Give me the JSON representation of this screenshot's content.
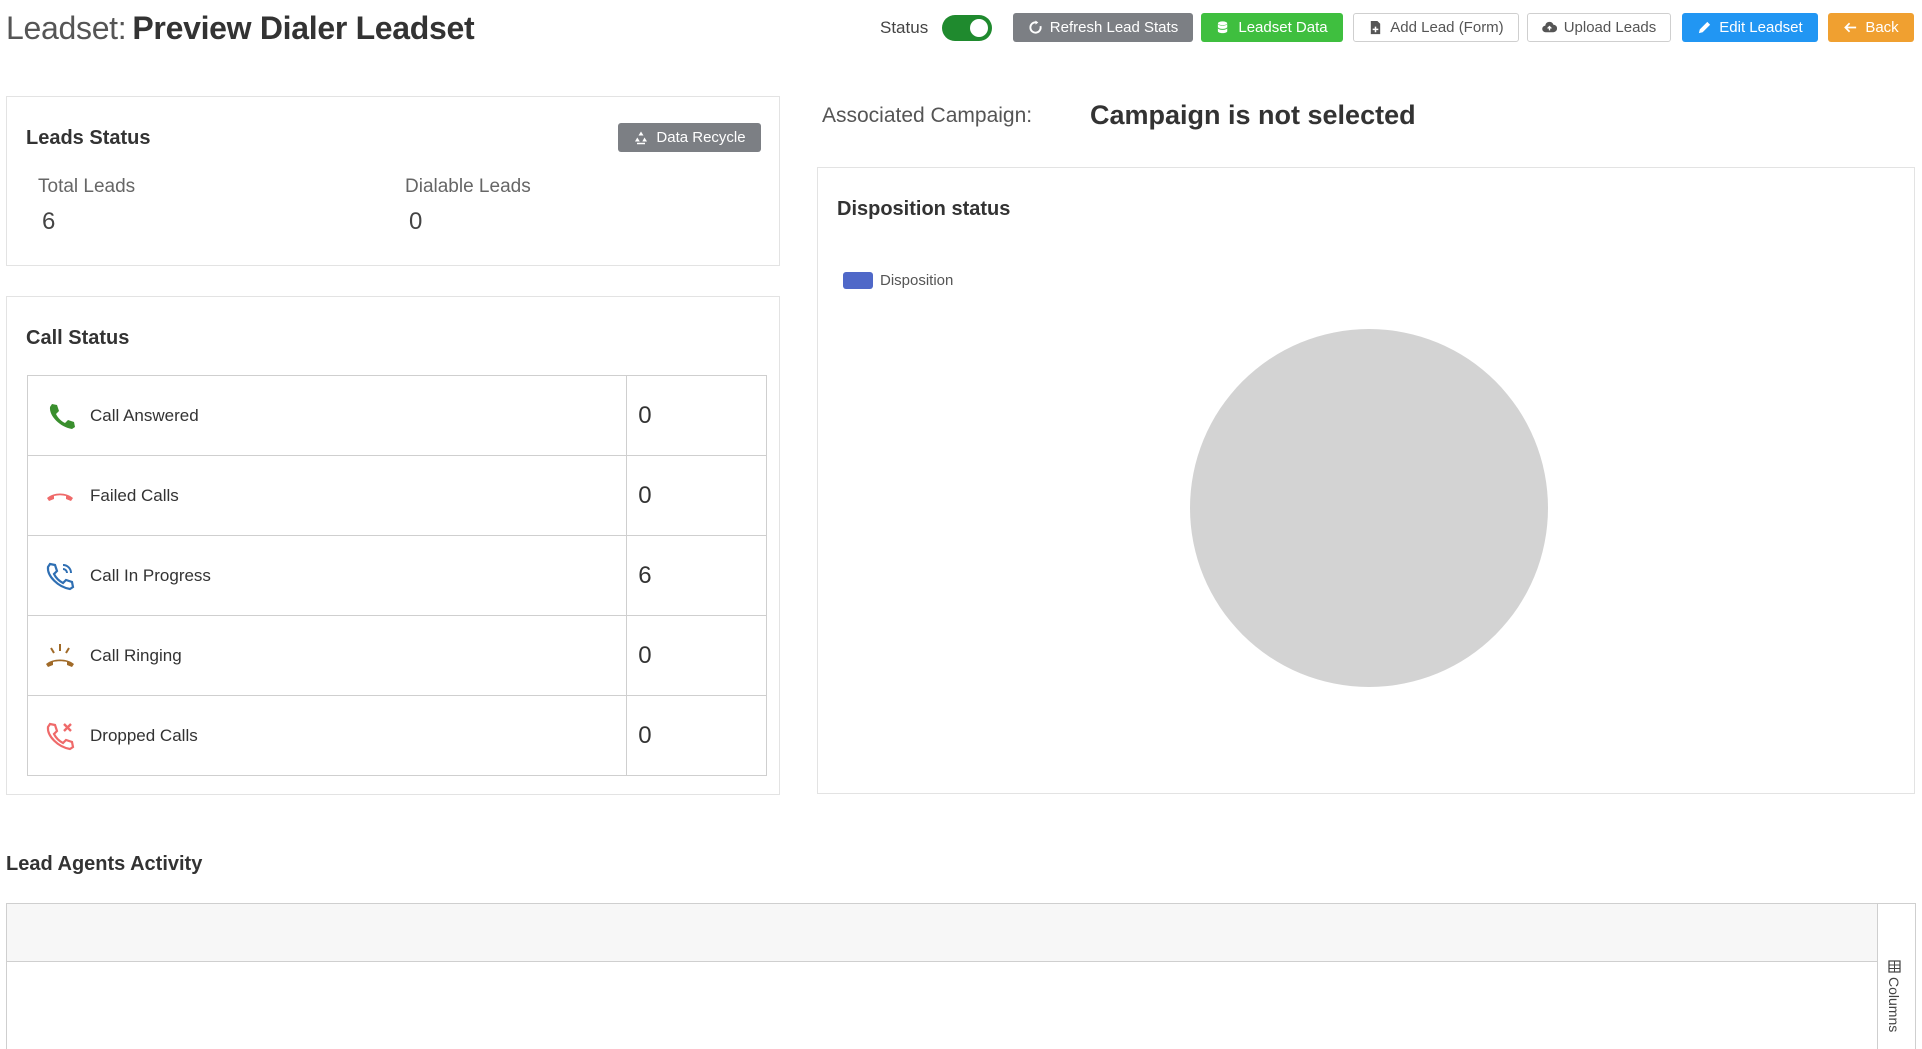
{
  "header": {
    "title_prefix": "Leadset:",
    "title_name": "Preview Dialer Leadset",
    "status_label": "Status",
    "status_on": true,
    "buttons": {
      "refresh": "Refresh Lead Stats",
      "leadset_data": "Leadset Data",
      "add_lead": "Add Lead (Form)",
      "upload": "Upload Leads",
      "edit": "Edit Leadset",
      "back": "Back"
    }
  },
  "leads_status": {
    "title": "Leads Status",
    "recycle_button": "Data Recycle",
    "total_label": "Total Leads",
    "total_value": "6",
    "dialable_label": "Dialable Leads",
    "dialable_value": "0"
  },
  "call_status": {
    "title": "Call Status",
    "rows": [
      {
        "label": "Call Answered",
        "value": "0",
        "icon": "phone-answered-icon",
        "color": "#3a8f2e"
      },
      {
        "label": "Failed Calls",
        "value": "0",
        "icon": "phone-hangup-icon",
        "color": "#ef6a6a"
      },
      {
        "label": "Call In Progress",
        "value": "6",
        "icon": "phone-in-talk-icon",
        "color": "#2f6fb3"
      },
      {
        "label": "Call Ringing",
        "value": "0",
        "icon": "phone-ringing-icon",
        "color": "#a06a28"
      },
      {
        "label": "Dropped Calls",
        "value": "0",
        "icon": "phone-missed-icon",
        "color": "#ef6a6a"
      }
    ]
  },
  "campaign": {
    "label": "Associated Campaign:",
    "value": "Campaign is not selected"
  },
  "disposition": {
    "title": "Disposition status"
  },
  "chart_data": {
    "type": "pie",
    "series": [
      {
        "name": "Disposition",
        "values": []
      }
    ],
    "legend": "top-left",
    "empty_color": "#d3d3d3",
    "series_color": "#4f68c8"
  },
  "agents": {
    "title": "Lead Agents Activity",
    "columns_tab": "Columns"
  },
  "colors": {
    "toggle_on": "#1f8a2e",
    "refresh": "#7c7f84",
    "leadset": "#3fbf3f",
    "edit": "#2196f3",
    "back": "#f0a030"
  }
}
